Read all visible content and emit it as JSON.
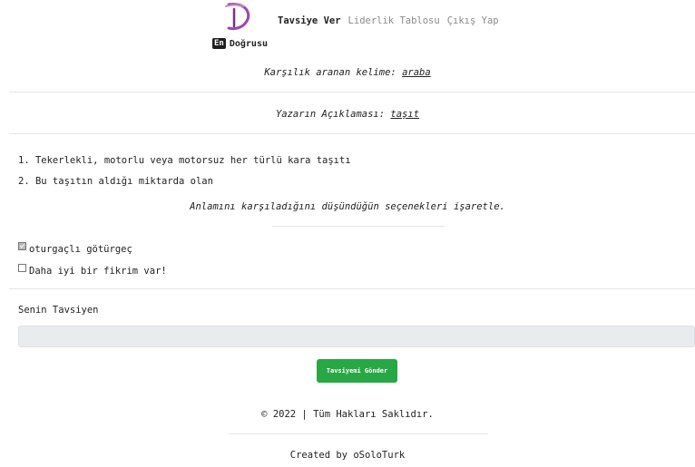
{
  "nav": {
    "items": [
      {
        "label": "Tavsiye Ver",
        "active": true
      },
      {
        "label": "Liderlik Tablosu",
        "active": false
      },
      {
        "label": "Çıkış Yap",
        "active": false
      }
    ]
  },
  "brand": {
    "badge": "En",
    "name": "Doğrusu",
    "logo_color": "#9b4aa8"
  },
  "word": {
    "label": "Karşılık aranan kelime:",
    "value": "araba"
  },
  "author_desc": {
    "label": "Yazarın Açıklaması:",
    "value": "taşıt"
  },
  "definitions": [
    "1. Tekerlekli, motorlu veya motorsuz her türlü kara taşıtı",
    "2. Bu taşıtın aldığı miktarda olan"
  ],
  "instruction": "Anlamını karşıladığını düşündüğün seçenekleri işaretle.",
  "options": [
    {
      "label": "oturgaçlı götürgeç",
      "checked": true
    },
    {
      "label": "Daha iyi bir fikrim var!",
      "checked": false
    }
  ],
  "advice": {
    "label": "Senin Tavsiyen",
    "value": "",
    "placeholder": ""
  },
  "submit_label": "Tavsiyemi Gönder",
  "footer": {
    "copyright": "© 2022 | Tüm Hakları Saklıdır.",
    "credit": "Created by oSoloTurk"
  },
  "colors": {
    "button": "#28a745",
    "input_bg": "#e9ecef",
    "nav_inactive": "#8a8a8a"
  }
}
